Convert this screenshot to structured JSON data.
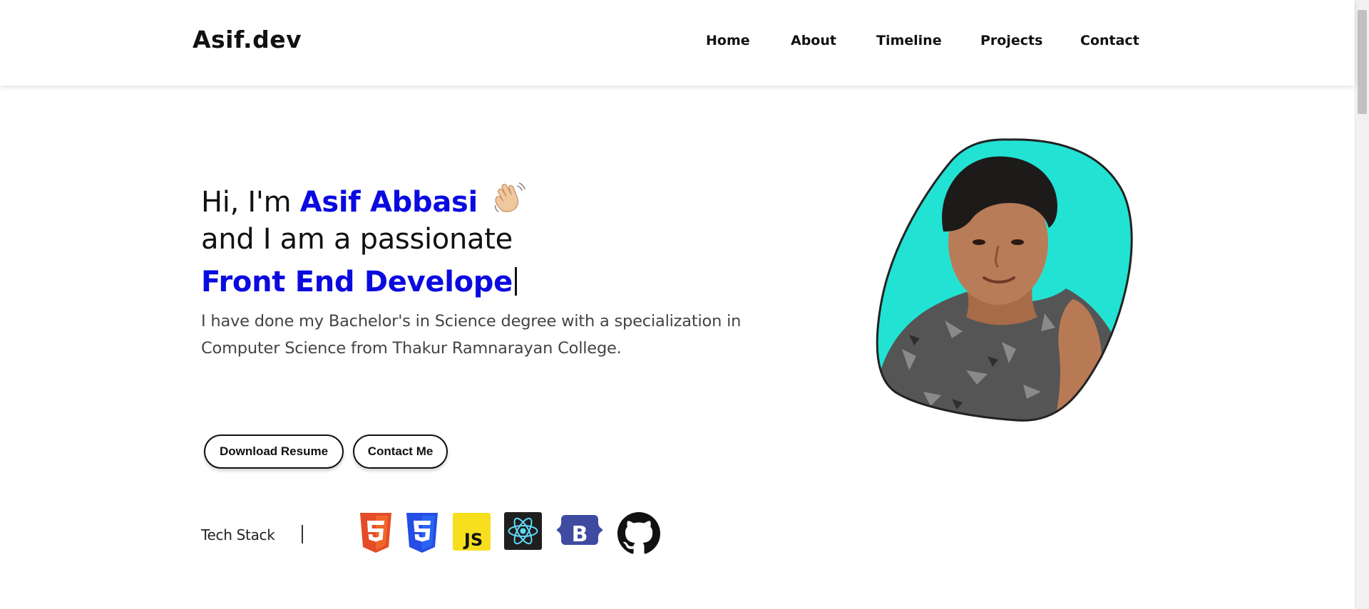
{
  "header": {
    "logo": "Asif.dev",
    "nav": [
      "Home",
      "About",
      "Timeline",
      "Projects",
      "Contact"
    ]
  },
  "hero": {
    "greeting_prefix": "Hi, I'm ",
    "name": "Asif Abbasi",
    "wave_emoji": "waving-hand",
    "line2": "and I am a passionate",
    "role": "Front End Develope",
    "description": "I have done my Bachelor's in Science degree with a specialization in Computer Science from Thakur Ramnarayan College."
  },
  "buttons": {
    "resume": "Download Resume",
    "contact": "Contact Me"
  },
  "tech_stack": {
    "label": "Tech Stack",
    "icons": [
      "html5-icon",
      "css3-icon",
      "javascript-icon",
      "react-icon",
      "bootstrap-icon",
      "github-icon"
    ]
  },
  "colors": {
    "accent": "#0a0ae0",
    "avatar_bg": "#22e3d3"
  }
}
